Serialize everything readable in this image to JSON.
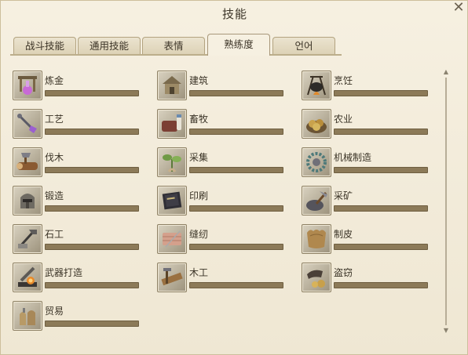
{
  "window": {
    "title": "技能",
    "close_glyph": "✕"
  },
  "tabs": [
    {
      "label": "战斗技能",
      "active": false
    },
    {
      "label": "通用技能",
      "active": false
    },
    {
      "label": "表情",
      "active": false
    },
    {
      "label": "熟练度",
      "active": true
    },
    {
      "label": "언어",
      "active": false
    }
  ],
  "skills": [
    {
      "name": "炼金",
      "icon": "alchemy-icon",
      "progress": 0
    },
    {
      "name": "建筑",
      "icon": "construction-icon",
      "progress": 0
    },
    {
      "name": "烹饪",
      "icon": "cooking-icon",
      "progress": 0
    },
    {
      "name": "工艺",
      "icon": "handicraft-icon",
      "progress": 0
    },
    {
      "name": "畜牧",
      "icon": "husbandry-icon",
      "progress": 0
    },
    {
      "name": "农业",
      "icon": "farming-icon",
      "progress": 0
    },
    {
      "name": "伐木",
      "icon": "logging-icon",
      "progress": 0
    },
    {
      "name": "采集",
      "icon": "gathering-icon",
      "progress": 0
    },
    {
      "name": "机械制造",
      "icon": "machining-icon",
      "progress": 0
    },
    {
      "name": "锻造",
      "icon": "metalwork-icon",
      "progress": 0
    },
    {
      "name": "印刷",
      "icon": "printing-icon",
      "progress": 0
    },
    {
      "name": "采矿",
      "icon": "mining-icon",
      "progress": 0
    },
    {
      "name": "石工",
      "icon": "masonry-icon",
      "progress": 0
    },
    {
      "name": "缝纫",
      "icon": "tailoring-icon",
      "progress": 0
    },
    {
      "name": "制皮",
      "icon": "leatherwork-icon",
      "progress": 0
    },
    {
      "name": "武器打造",
      "icon": "weaponry-icon",
      "progress": 0
    },
    {
      "name": "木工",
      "icon": "carpentry-icon",
      "progress": 0
    },
    {
      "name": "盗窃",
      "icon": "larceny-icon",
      "progress": 0
    },
    {
      "name": "贸易",
      "icon": "commerce-icon",
      "progress": 0
    }
  ],
  "colors": {
    "bar_empty": "#8c7a58",
    "bar_fill": "#c9a55a",
    "panel_bg": "#f1ead8"
  }
}
